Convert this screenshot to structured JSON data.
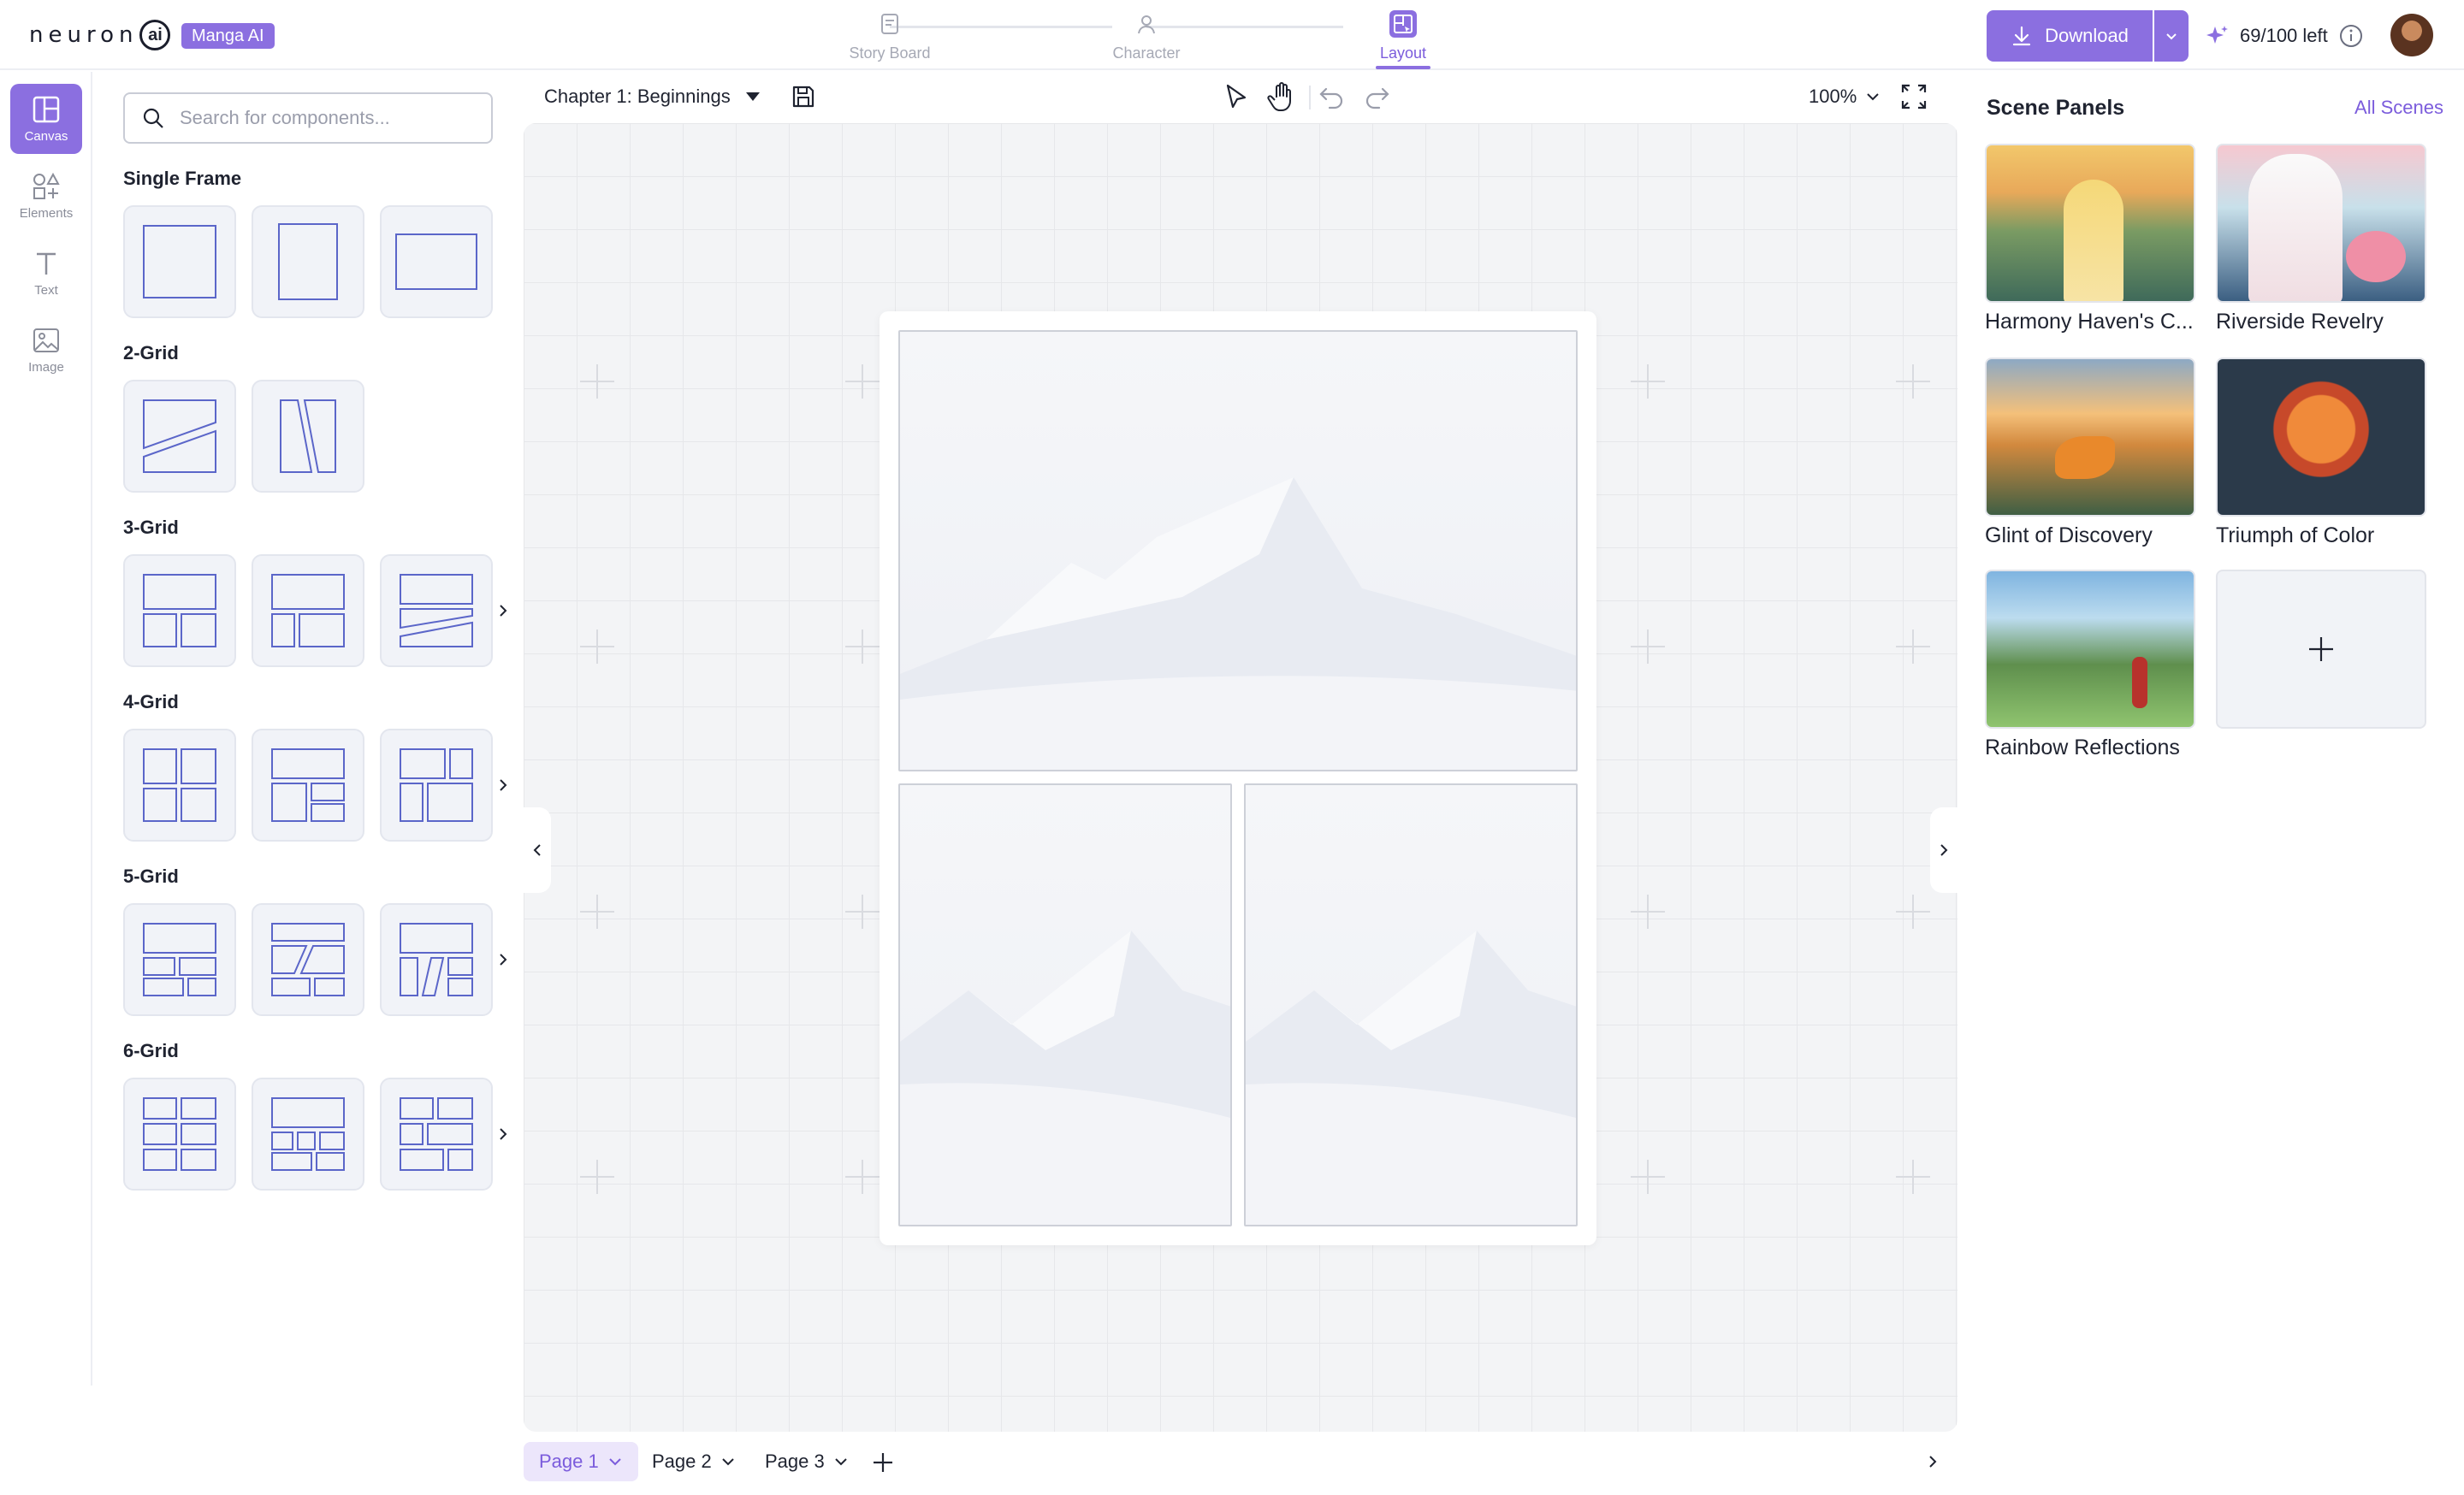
{
  "brand": {
    "logo_text": "neuron",
    "logo_ai": "ai",
    "badge": "Manga AI"
  },
  "steps": [
    {
      "label": "Story Board",
      "icon": "storyboard-icon"
    },
    {
      "label": "Character",
      "icon": "character-icon"
    },
    {
      "label": "Layout",
      "icon": "layout-icon",
      "active": true
    }
  ],
  "header": {
    "download_label": "Download",
    "credits": "69/100 left"
  },
  "rail": [
    {
      "label": "Canvas",
      "icon": "canvas-icon",
      "active": true
    },
    {
      "label": "Elements",
      "icon": "elements-icon"
    },
    {
      "label": "Text",
      "icon": "text-icon"
    },
    {
      "label": "Image",
      "icon": "image-icon"
    }
  ],
  "components": {
    "search_placeholder": "Search for components...",
    "sections": [
      "Single Frame",
      "2-Grid",
      "3-Grid",
      "4-Grid",
      "5-Grid",
      "6-Grid"
    ]
  },
  "canvas": {
    "chapter": "Chapter 1: Beginnings",
    "zoom": "100%"
  },
  "pages": [
    "Page 1",
    "Page 2",
    "Page 3"
  ],
  "scenes": {
    "title": "Scene Panels",
    "all_link": "All Scenes",
    "items": [
      "Harmony Haven's C...",
      "Riverside Revelry",
      "Glint of Discovery",
      "Triumph of Color",
      "Rainbow Reflections"
    ]
  },
  "colors": {
    "accent": "#8b6fe0",
    "accent_text": "#7b5cdc",
    "canvas_bg": "#f3f4f6"
  }
}
